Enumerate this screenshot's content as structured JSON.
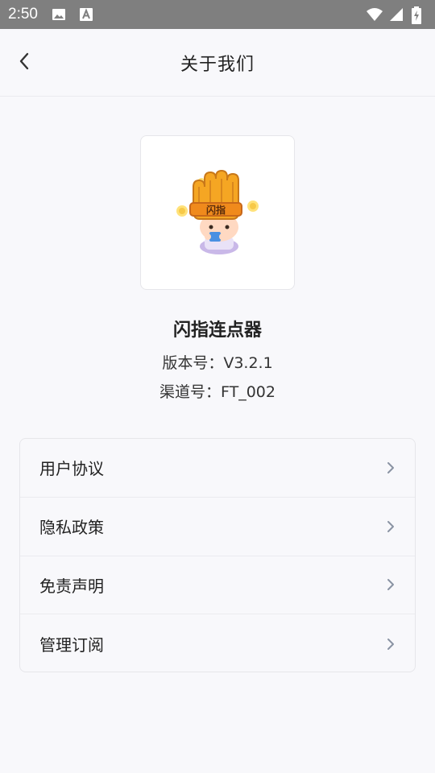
{
  "status_bar": {
    "time": "2:50",
    "icons": [
      "image-icon",
      "text-a-icon",
      "wifi-icon",
      "signal-icon",
      "battery-charging-icon"
    ]
  },
  "header": {
    "title": "关于我们",
    "back_icon": "chevron-left-icon"
  },
  "app": {
    "name": "闪指连点器",
    "version": "版本号：V3.2.1",
    "channel": "渠道号：FT_002",
    "logo_text": "闪指"
  },
  "menu": {
    "items": [
      {
        "label": "用户协议",
        "icon": "chevron-right-icon"
      },
      {
        "label": "隐私政策",
        "icon": "chevron-right-icon"
      },
      {
        "label": "免责声明",
        "icon": "chevron-right-icon"
      },
      {
        "label": "管理订阅",
        "icon": "chevron-right-icon"
      }
    ]
  },
  "colors": {
    "status_bar_bg": "#7f7f7f",
    "page_bg": "#f8f8fb",
    "logo_orange": "#f5a623",
    "chevron": "#8a93a3"
  }
}
